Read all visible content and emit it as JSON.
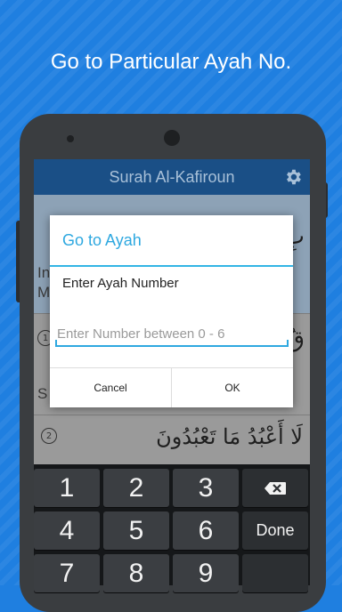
{
  "promo": {
    "title": "Go to Particular Ayah No."
  },
  "app": {
    "title": "Surah Al-Kafiroun",
    "settings_icon": "gear-icon"
  },
  "background_rows": {
    "row1_lines": [
      "In",
      "M"
    ],
    "row1_arabic": "بِ",
    "row2_verse_number": "1",
    "row2_letter": "S",
    "row2_arabic": "قُ",
    "row3_verse_number": "2",
    "row3_arabic": "لَا أَعْبُدُ مَا تَعْبُدُونَ"
  },
  "dialog": {
    "title": "Go to Ayah",
    "label": "Enter Ayah Number",
    "input_value": "",
    "input_placeholder": "Enter Number between 0 - 6",
    "cancel_label": "Cancel",
    "ok_label": "OK",
    "accent_color": "#33b5e5"
  },
  "keyboard": {
    "row1": [
      "1",
      "2",
      "3"
    ],
    "row2": [
      "4",
      "5",
      "6"
    ],
    "row3": [
      "7",
      "8",
      "9"
    ],
    "done_label": "Done",
    "backspace_icon": "backspace-icon"
  },
  "colors": {
    "background": "#1f7fe0",
    "app_bar": "#1a4f86"
  }
}
